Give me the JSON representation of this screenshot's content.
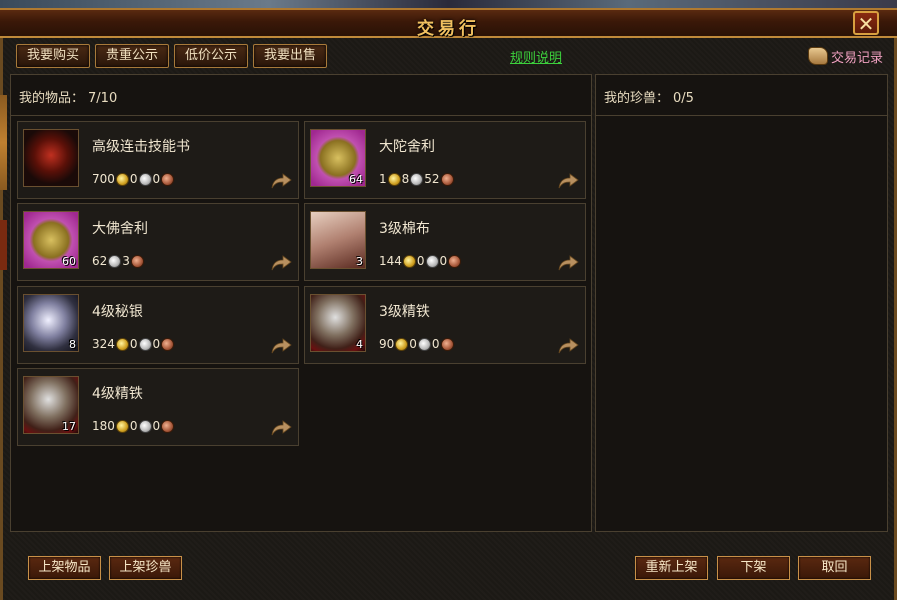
{
  "window": {
    "title": "交易行",
    "close_label": "✕"
  },
  "tabs": [
    {
      "label": "我要购买"
    },
    {
      "label": "贵重公示"
    },
    {
      "label": "低价公示"
    },
    {
      "label": "我要出售"
    }
  ],
  "rules_link": "规则说明",
  "trade_log": "交易记录",
  "my_items": {
    "label": "我的物品：",
    "count": "7/10",
    "items": [
      {
        "name": "高级连击技能书",
        "qty": "",
        "gold": "700",
        "silver": "0",
        "copper": "0",
        "icon": "skill-book-icon"
      },
      {
        "name": "大陀舍利",
        "qty": "64",
        "gold": "1",
        "silver": "8",
        "copper": "52",
        "icon": "buddha-relic-icon"
      },
      {
        "name": "大佛舍利",
        "qty": "60",
        "gold": "",
        "silver": "62",
        "copper": "3",
        "icon": "buddha-relic-icon"
      },
      {
        "name": "3级棉布",
        "qty": "3",
        "gold": "144",
        "silver": "0",
        "copper": "0",
        "icon": "cotton-cloth-icon"
      },
      {
        "name": "4级秘银",
        "qty": "8",
        "gold": "324",
        "silver": "0",
        "copper": "0",
        "icon": "mithril-ore-icon"
      },
      {
        "name": "3级精铁",
        "qty": "4",
        "gold": "90",
        "silver": "0",
        "copper": "0",
        "icon": "iron-ore-icon"
      },
      {
        "name": "4级精铁",
        "qty": "17",
        "gold": "180",
        "silver": "0",
        "copper": "0",
        "icon": "iron-ore-icon"
      }
    ]
  },
  "my_pets": {
    "label": "我的珍兽：",
    "count": "0/5"
  },
  "buttons": {
    "list_item": "上架物品",
    "list_pet": "上架珍兽",
    "relist": "重新上架",
    "delist": "下架",
    "cancel": "取回"
  }
}
